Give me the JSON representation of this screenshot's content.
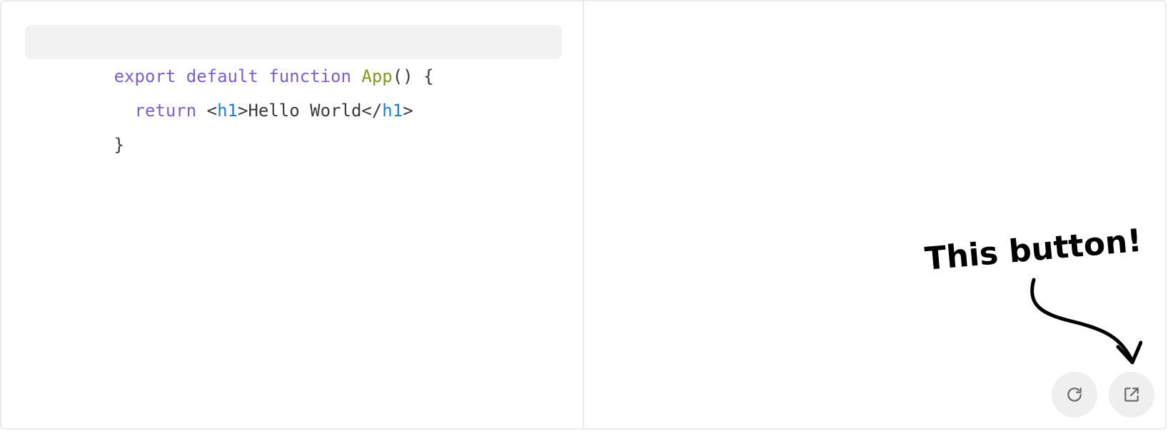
{
  "code": {
    "lines": [
      {
        "tokens": [
          {
            "cls": "kw",
            "text": "export default function "
          },
          {
            "cls": "fn",
            "text": "App"
          },
          {
            "cls": "punc",
            "text": "() {"
          }
        ]
      },
      {
        "tokens": [
          {
            "cls": "kw",
            "text": "  return "
          },
          {
            "cls": "punc",
            "text": "<"
          },
          {
            "cls": "tag",
            "text": "h1"
          },
          {
            "cls": "punc",
            "text": ">Hello World</"
          },
          {
            "cls": "tag",
            "text": "h1"
          },
          {
            "cls": "punc",
            "text": ">"
          }
        ]
      },
      {
        "tokens": [
          {
            "cls": "punc",
            "text": "}"
          }
        ]
      }
    ]
  },
  "annotation": {
    "text": "This button!"
  },
  "preview": {
    "buttons": [
      {
        "name": "refresh-button",
        "icon": "refresh-icon"
      },
      {
        "name": "open-in-new-window-button",
        "icon": "external-link-icon"
      }
    ]
  },
  "colors": {
    "keyword": "#7b5fd1",
    "function": "#7f9a1e",
    "tag": "#1e7fd1",
    "active_line": "#f2f2f2",
    "button_bg": "#efefef"
  }
}
